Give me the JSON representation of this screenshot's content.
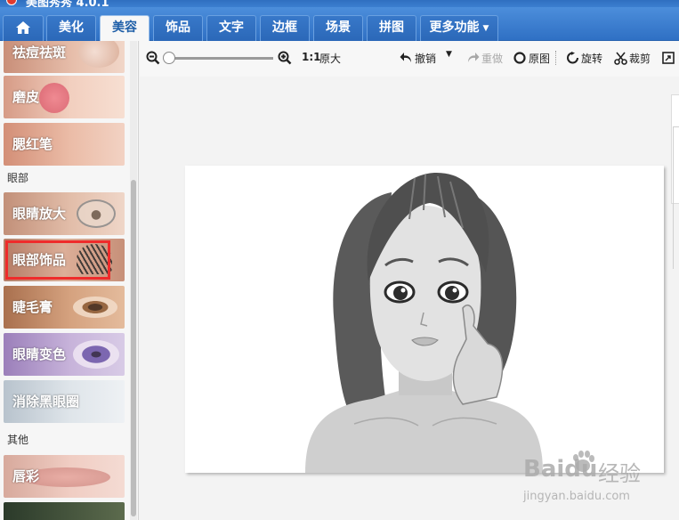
{
  "app": {
    "title": "美图秀秀 4.0.1"
  },
  "tabs": [
    {
      "label": "美化",
      "active": false
    },
    {
      "label": "美容",
      "active": true
    },
    {
      "label": "饰品",
      "active": false
    },
    {
      "label": "文字",
      "active": false
    },
    {
      "label": "边框",
      "active": false
    },
    {
      "label": "场景",
      "active": false
    },
    {
      "label": "拼图",
      "active": false
    },
    {
      "label": "更多功能",
      "active": false,
      "has_dropdown": true
    }
  ],
  "sidebar": {
    "items_top": [
      {
        "label": "祛痘祛斑",
        "color": "#d9a98f"
      },
      {
        "label": "磨皮",
        "color": "#e7b9a2"
      },
      {
        "label": "腮红笔",
        "color": "#dfa58b"
      }
    ],
    "section_eyes": "眼部",
    "items_eyes": [
      {
        "label": "眼睛放大",
        "color": "#caa08a"
      },
      {
        "label": "眼部饰品",
        "color": "#c99a86",
        "highlighted": true
      },
      {
        "label": "睫毛膏",
        "color": "#b9845f"
      },
      {
        "label": "眼睛变色",
        "color": "#a48ac0"
      },
      {
        "label": "消除黑眼圈",
        "color": "#c9cfd6"
      }
    ],
    "section_other": "其他",
    "items_other": [
      {
        "label": "唇彩",
        "color": "#dcb0a5"
      }
    ]
  },
  "toolbar": {
    "zoom_ratio": "1:1",
    "original_size": "原大",
    "undo": "撤销",
    "redo": "重做",
    "original": "原图",
    "rotate": "旋转",
    "crop": "裁剪",
    "zoom_slider_level": 0.0
  },
  "watermark": {
    "brand": "Baidu",
    "cn": "经验",
    "url": "jingyan.baidu.com"
  }
}
